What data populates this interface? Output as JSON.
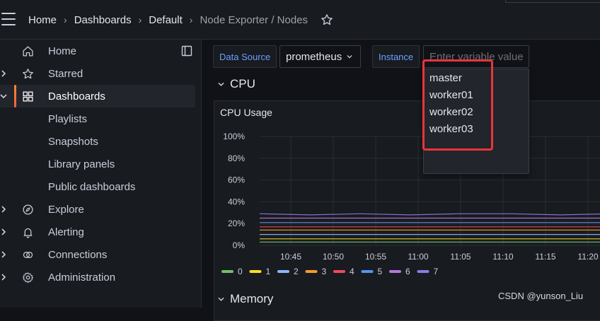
{
  "topbar": {
    "breadcrumbs": [
      "Home",
      "Dashboards",
      "Default"
    ],
    "current": "Node Exporter / Nodes",
    "separator": "›"
  },
  "sidebar": {
    "items": [
      {
        "label": "Home",
        "icon": "home-icon"
      },
      {
        "label": "Starred",
        "icon": "star-icon"
      },
      {
        "label": "Dashboards",
        "icon": "grid-icon",
        "active": true
      },
      {
        "label": "Playlists"
      },
      {
        "label": "Snapshots"
      },
      {
        "label": "Library panels"
      },
      {
        "label": "Public dashboards"
      },
      {
        "label": "Explore",
        "icon": "compass-icon"
      },
      {
        "label": "Alerting",
        "icon": "bell-icon"
      },
      {
        "label": "Connections",
        "icon": "connections-icon"
      },
      {
        "label": "Administration",
        "icon": "gear-icon"
      }
    ]
  },
  "variables": {
    "datasource_label": "Data Source",
    "datasource_value": "prometheus",
    "instance_label": "Instance",
    "instance_placeholder": "Enter variable value"
  },
  "dropdown": {
    "options": [
      "master",
      "worker01",
      "worker02",
      "worker03"
    ]
  },
  "rows": {
    "cpu": "CPU",
    "memory": "Memory"
  },
  "panel": {
    "title": "CPU Usage"
  },
  "chart_data": {
    "type": "line",
    "title": "CPU Usage",
    "x": [
      "10:45",
      "10:50",
      "10:55",
      "11:00",
      "11:05",
      "11:10",
      "11:15",
      "11:20"
    ],
    "y_ticks": [
      "0%",
      "20%",
      "40%",
      "60%",
      "80%",
      "100%"
    ],
    "ylim": [
      0,
      100
    ],
    "grid": true,
    "legend_position": "bottom",
    "series": [
      {
        "name": "0",
        "color": "#73bf69",
        "values": [
          3,
          3,
          3,
          3,
          3,
          3,
          3,
          3
        ]
      },
      {
        "name": "1",
        "color": "#fade2a",
        "values": [
          6,
          6,
          6,
          6,
          6,
          6,
          6,
          6
        ]
      },
      {
        "name": "2",
        "color": "#8ab8ff",
        "values": [
          10,
          10,
          10,
          10,
          10,
          10,
          10,
          10
        ]
      },
      {
        "name": "3",
        "color": "#ff9830",
        "values": [
          14,
          14,
          14,
          14,
          14,
          14,
          14,
          14
        ]
      },
      {
        "name": "4",
        "color": "#f2495c",
        "values": [
          17,
          17,
          17,
          17,
          17,
          17,
          17,
          17
        ]
      },
      {
        "name": "5",
        "color": "#5794f2",
        "values": [
          21,
          21,
          21,
          21,
          21,
          21,
          21,
          21
        ]
      },
      {
        "name": "6",
        "color": "#b877d9",
        "values": [
          25,
          25,
          25,
          25,
          25,
          25,
          25,
          25
        ]
      },
      {
        "name": "7",
        "color": "#8f7ae6",
        "values": [
          29,
          28,
          29,
          28,
          29,
          29,
          28,
          29
        ]
      }
    ]
  },
  "watermark": "CSDN @yunson_Liu",
  "colors": {
    "accent": "#ff8833",
    "highlight": "#e8353a",
    "link": "#6e9fff"
  }
}
